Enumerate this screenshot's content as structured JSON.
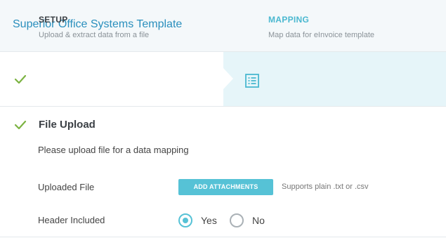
{
  "header": {
    "title": "Superior Office Systems Template"
  },
  "steps": [
    {
      "title": "SETUP",
      "subtitle": "Upload & extract data from a file",
      "status": "complete"
    },
    {
      "title": "MAPPING",
      "subtitle": "Map data for eInvoice template",
      "status": "active"
    }
  ],
  "file_upload": {
    "title": "File Upload",
    "description": "Please upload file for a data mapping",
    "uploaded_file_label": "Uploaded File",
    "attach_button_label": "ADD ATTACHMENTS",
    "support_text": "Supports plain .txt or .csv",
    "header_included_label": "Header Included",
    "options": [
      {
        "label": "Yes",
        "selected": true
      },
      {
        "label": "No",
        "selected": false
      }
    ]
  },
  "colors": {
    "accent": "#56c2d6",
    "title_blue": "#2a8fbd",
    "check_green": "#7cb342",
    "active_step_bg": "#e6f5f9"
  },
  "icons": {
    "setup": "check-icon",
    "mapping": "list-icon",
    "section": "check-icon"
  }
}
